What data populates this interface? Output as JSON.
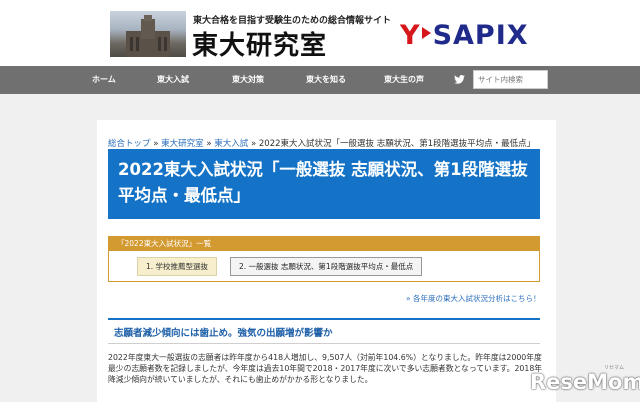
{
  "header": {
    "tagline": "東大合格を目指す受験生のための総合情報サイト",
    "site_name": "東大研究室",
    "partner_logo": {
      "y": "Y",
      "rest": "SAPIX",
      "brand_color": "#1f2a8a",
      "accent_color": "#d5161b"
    }
  },
  "nav": {
    "items": [
      "ホーム",
      "東大入試",
      "東大対策",
      "東大を知る",
      "東大生の声"
    ],
    "twitter_icon": "twitter-icon",
    "search_placeholder": "サイト内検索"
  },
  "breadcrumb": {
    "items": [
      "総合トップ",
      "東大研究室",
      "東大入試"
    ],
    "separator": "»",
    "current": "2022東大入試状況「一般選抜 志願状況、第1段階選抜平均点・最低点」"
  },
  "article": {
    "title": "2022東大入試状況「一般選抜 志願状況、第1段階選抜平均点・最低点」",
    "series": {
      "heading": "「2022東大入試状況」一覧",
      "items": [
        "1. 学校推薦型選抜",
        "2. 一般選抜 志願状況、第1段階選抜平均点・最低点"
      ]
    },
    "more_link": "» 各年度の東大入試状況分析はこちら！",
    "section_heading": "志願者減少傾向には歯止め。強気の出願増が影響か",
    "body_lines": [
      "2022年度東大一般選抜の志願者は昨年度から418人増加し、9,507人（対前年104.6%）となりました。昨年度は2000年度以降",
      "最少の志願者数を記録しましたが、今年度は過去10年間で2018・2017年度に次いで多い志願者数となっています。2018年度以",
      "降減少傾向が続いていましたが、それにも歯止めがかかる形となりました。"
    ]
  },
  "watermark": {
    "text": "ReseMom",
    "small": "リセマム"
  },
  "colors": {
    "title_bg": "#1473c6",
    "series_accent": "#d49a32",
    "nav_bg": "#707070"
  }
}
